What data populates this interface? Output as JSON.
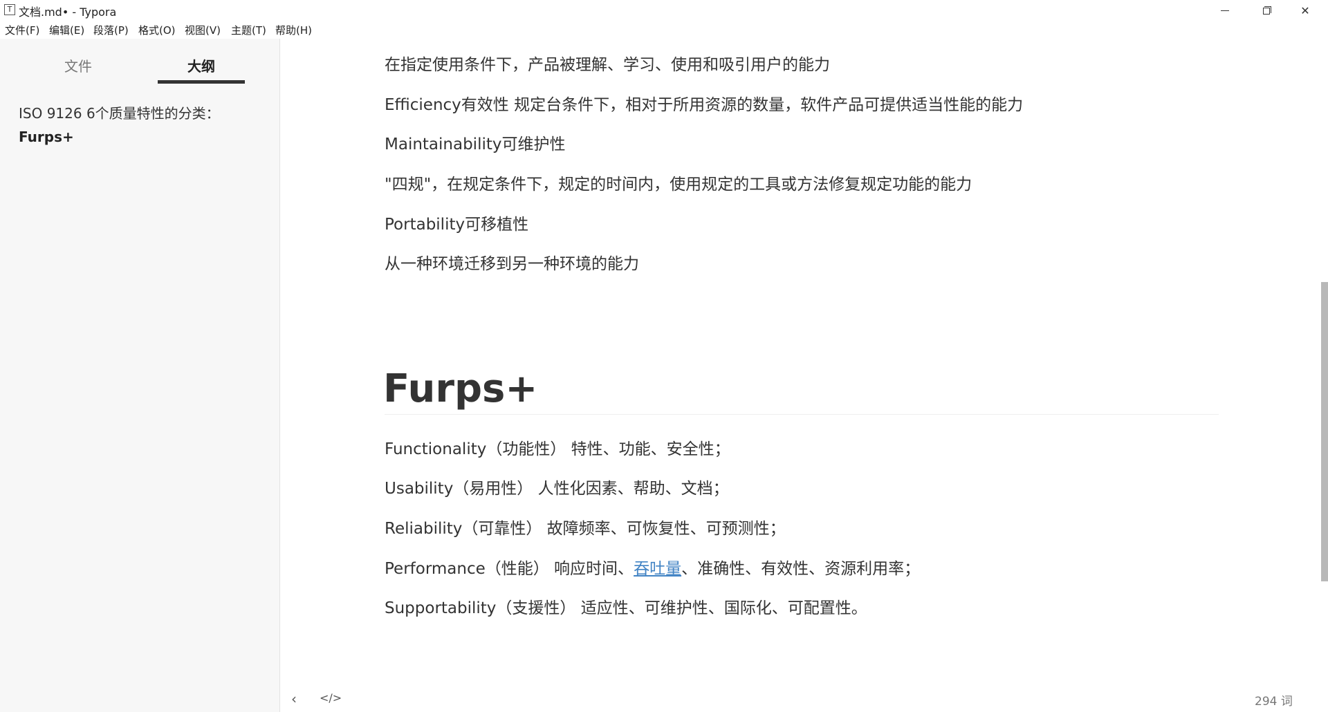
{
  "window": {
    "title": "文档.md• - Typora",
    "icon_letter": "T"
  },
  "menu": {
    "items": [
      "文件(F)",
      "编辑(E)",
      "段落(P)",
      "格式(O)",
      "视图(V)",
      "主题(T)",
      "帮助(H)"
    ]
  },
  "sidebar": {
    "tabs": [
      "文件",
      "大纲"
    ],
    "active_tab": "大纲",
    "outline": [
      "ISO 9126 6个质量特性的分类：",
      "Furps+"
    ]
  },
  "editor": {
    "paragraphs_top": [
      "在指定使用条件下，产品被理解、学习、使用和吸引用户的能力",
      "Efficiency有效性 规定台条件下，相对于所用资源的数量，软件产品可提供适当性能的能力",
      "Maintainability可维护性",
      "\"四规\"，在规定条件下，规定的时间内，使用规定的工具或方法修复规定功能的能力",
      "Portability可移植性",
      "从一种环境迁移到另一种环境的能力"
    ],
    "heading": "Furps+",
    "paragraphs_bottom": [
      "Functionality（功能性） 特性、功能、安全性；",
      "Usability（易用性） 人性化因素、帮助、文档；",
      "Reliability（可靠性） 故障频率、可恢复性、可预测性；",
      "Supportability（支援性） 适应性、可维护性、国际化、可配置性。"
    ],
    "performance_line": {
      "before": "Performance（性能） 响应时间、",
      "link": "吞吐量",
      "after": "、准确性、有效性、资源利用率；"
    }
  },
  "footer": {
    "back_icon": "chevron-left-icon",
    "source_icon": "code-icon",
    "word_count": "294 词"
  },
  "colors": {
    "link": "#4183c4",
    "sidebar_bg": "#f7f7f7",
    "text": "#333333"
  }
}
